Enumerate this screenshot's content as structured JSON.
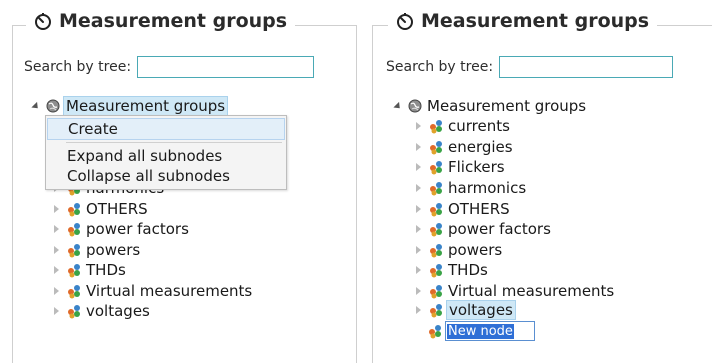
{
  "panel_left": {
    "title": "Measurement groups",
    "search_label": "Search by tree:",
    "search_value": "",
    "root_label": "Measurement groups",
    "items": [
      {
        "label": "harmonics"
      },
      {
        "label": "OTHERS"
      },
      {
        "label": "power factors"
      },
      {
        "label": "powers"
      },
      {
        "label": "THDs"
      },
      {
        "label": "Virtual measurements"
      },
      {
        "label": "voltages"
      }
    ],
    "context_menu": {
      "items": [
        {
          "label": "Create"
        },
        {
          "label": "Expand all subnodes"
        },
        {
          "label": "Collapse all subnodes"
        }
      ]
    }
  },
  "panel_right": {
    "title": "Measurement groups",
    "search_label": "Search by tree:",
    "search_value": "",
    "root_label": "Measurement groups",
    "items": [
      {
        "label": "currents"
      },
      {
        "label": "energies"
      },
      {
        "label": "Flickers"
      },
      {
        "label": "harmonics"
      },
      {
        "label": "OTHERS"
      },
      {
        "label": "power factors"
      },
      {
        "label": "powers"
      },
      {
        "label": "THDs"
      },
      {
        "label": "Virtual measurements"
      },
      {
        "label": "voltages"
      }
    ],
    "new_node_value": "New node"
  },
  "colors": {
    "selection": "#cfe8f6",
    "input_border": "#4aa9b5",
    "edit_highlight": "#2f6fd6"
  },
  "icons": {
    "legend": "timer-icon",
    "root": "globe-icon",
    "group": "group-icon"
  }
}
